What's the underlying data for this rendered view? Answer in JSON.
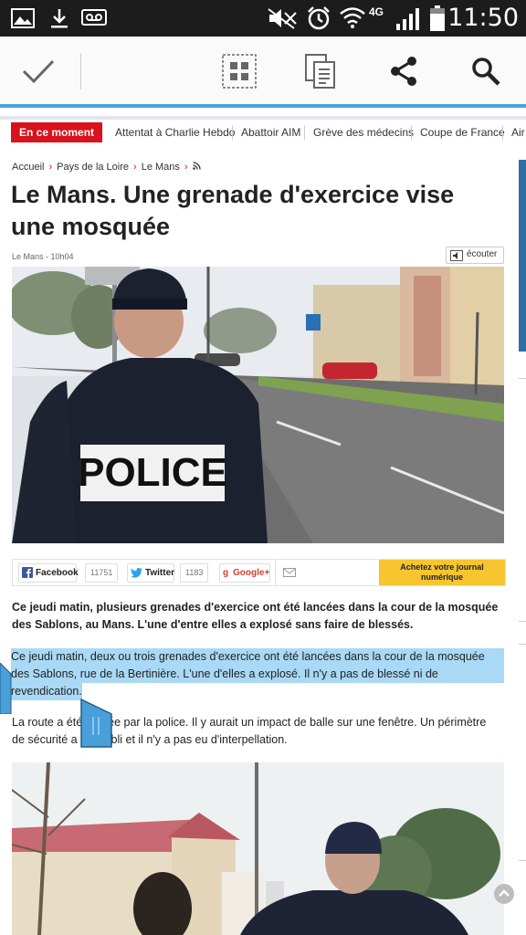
{
  "status_bar": {
    "time": "11:50",
    "network": "4G",
    "icons": [
      "gallery-icon",
      "download-icon",
      "voicemail-icon",
      "mute-icon",
      "alarm-icon",
      "wifi-icon",
      "signal-icon",
      "battery-icon"
    ]
  },
  "action_bar": {
    "icons": [
      "check-icon",
      "grid-icon",
      "copy-icon",
      "share-icon",
      "search-icon"
    ],
    "accent": "#4aa3df"
  },
  "trending": {
    "label": "En ce moment",
    "items": [
      "Attentat à Charlie Hebdo",
      "Abattoir AIM",
      "Grève des médecins",
      "Coupe de France",
      "Air"
    ]
  },
  "breadcrumb": {
    "items": [
      "Accueil",
      "Pays de la Loire",
      "Le Mans"
    ]
  },
  "article": {
    "title": "Le Mans. Une grenade d'exercice vise une mosquée",
    "meta": "Le Mans - 10h04",
    "listen_label": "écouter",
    "photo1_text": "POLICE",
    "lead": "Ce jeudi matin, plusieurs grenades d'exercice ont été lancées dans la cour de la mosquée des Sablons, au Mans. L'une d'entre elles a explosé sans faire de blessés.",
    "selected_line1": "Ce jeudi matin, deux ou trois grenades d'exercice ont été lancées dans la cour de la mosquée",
    "selected_line2": "des Sablons, rue de la Bertinière. L'une d'elles a explosé. Il n'y a pas de blessé ni de",
    "selected_line3": "revendication.",
    "para2_line1_a": "La route a été",
    "para2_line1_b": "ée par la police. Il y aurait un impact de balle sur une fenêtre. Un périmètre",
    "para2_line2_a": "de sécurité a",
    "para2_line2_b": "abli et il n'y a pas eu d'interpellation."
  },
  "share_bar": {
    "facebook_label": "Facebook",
    "facebook_count": "11751",
    "twitter_label": "Twitter",
    "twitter_count": "1183",
    "google_label": "Google+",
    "buy_line1": "Achetez votre journal",
    "buy_line2": "numérique"
  },
  "colors": {
    "brand_red": "#d9121b",
    "selection": "#a9d9f5",
    "buy_yellow": "#f6c52f"
  }
}
